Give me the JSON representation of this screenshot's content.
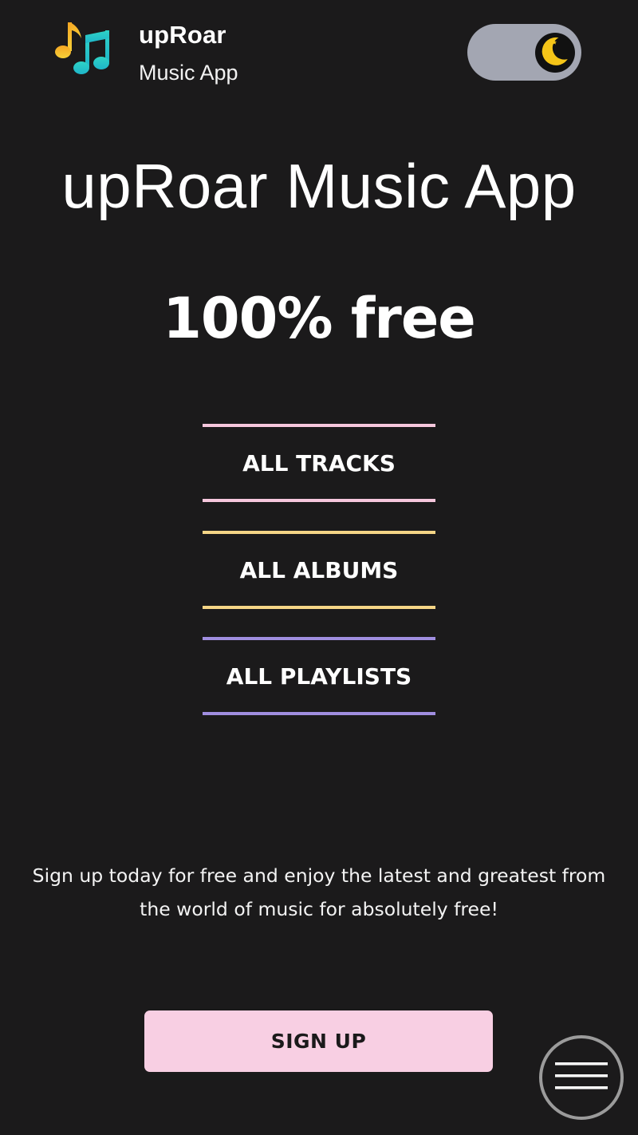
{
  "header": {
    "brand_name": "upRoar",
    "brand_subtitle": "Music App",
    "logo_icon": "music-notes-icon",
    "theme_toggle_icon": "moon-stars-icon"
  },
  "hero": {
    "title": "upRoar Music App",
    "subtitle": "100% free"
  },
  "categories": [
    {
      "label": "ALL TRACKS",
      "accent": "#f6c7dd"
    },
    {
      "label": "ALL ALBUMS",
      "accent": "#f5d586"
    },
    {
      "label": "ALL PLAYLISTS",
      "accent": "#a08ee0"
    }
  ],
  "blurb": "Sign up today for free and enjoy the latest and greatest from the world of music for absolutely free!",
  "signup": {
    "label": "SIGN UP",
    "color": "#f8cfe3"
  },
  "menu": {
    "icon": "hamburger-menu-icon"
  },
  "colors": {
    "background": "#1b1a1b",
    "toggle_track": "#a3a6b2",
    "moon": "#f5c518"
  }
}
